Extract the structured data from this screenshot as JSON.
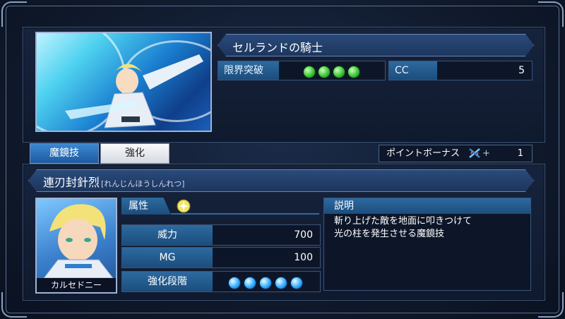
{
  "card": {
    "title": "セルランドの騎士",
    "limit_break_label": "限界突破",
    "limit_break_level": 4,
    "cc_label": "CC",
    "cc_value": "5"
  },
  "tabs": [
    {
      "label": "魔鏡技",
      "active": true
    },
    {
      "label": "強化",
      "active": false
    }
  ],
  "point_bonus": {
    "label": "ポイントボーナス",
    "icon": "sword-cross-icon",
    "plus": "+",
    "value": "1"
  },
  "skill": {
    "name": "連刃封針烈",
    "reading": "[れんじんほうしんれつ]",
    "attribute_label": "属性",
    "attribute_icon": "light-element-icon",
    "stats": [
      {
        "label": "威力",
        "value": "700"
      },
      {
        "label": "MG",
        "value": "100"
      }
    ],
    "enhance_label": "強化段階",
    "enhance_level": 5,
    "description_label": "説明",
    "description": "斬り上げた敵を地面に叩きつけて\n光の柱を発生させる魔鏡技"
  },
  "character": {
    "name": "カルセドニー"
  },
  "colors": {
    "accent": "#2d6aa0",
    "gem": "#3ec43e",
    "orb": "#3fb6ff",
    "background": "#101a2c"
  }
}
